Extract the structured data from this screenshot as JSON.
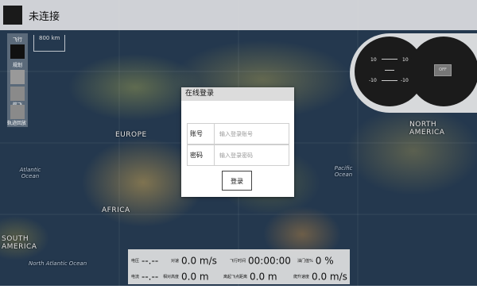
{
  "topbar": {
    "status": "未连接"
  },
  "sidebar": {
    "buttons": [
      {
        "label": "飞行",
        "color": "#111111"
      },
      {
        "label": "规划",
        "color": "#999999"
      },
      {
        "label": "航飞",
        "color": "#8a8a8a"
      },
      {
        "label": "轨迹回放",
        "color": "#8a8a8a"
      }
    ]
  },
  "map": {
    "scale_label": "800 km",
    "continents": [
      "EUROPE",
      "AFRICA",
      "NORTH AMERICA",
      "SOUTH AMERICA"
    ],
    "oceans": [
      "Atlantic Ocean",
      "Pacific Ocean",
      "North Atlantic Ocean"
    ]
  },
  "gauges": {
    "ticks": [
      "10",
      "10",
      "-10",
      "-10"
    ],
    "off_label": "OFF"
  },
  "login": {
    "title": "在线登录",
    "account_label": "账号",
    "account_placeholder": "输入登录账号",
    "password_label": "密码",
    "password_placeholder": "输入登录密码",
    "submit": "登录"
  },
  "telemetry": {
    "voltage_label": "电压",
    "voltage_value": "--.--",
    "airspeed_label": "对速",
    "airspeed_value": "0.0 m/s",
    "flight_time_label": "飞行时间",
    "flight_time_value": "00:00:00",
    "throttle_label": "油门值%",
    "throttle_value": "0 %",
    "current_label": "电流",
    "current_value": "--.--",
    "alt_label": "相对高度",
    "alt_value": "0.0 m",
    "home_label": "离起飞点距离",
    "home_value": "0.0 m",
    "climb_label": "爬升速度",
    "climb_value": "0.0 m/s"
  }
}
